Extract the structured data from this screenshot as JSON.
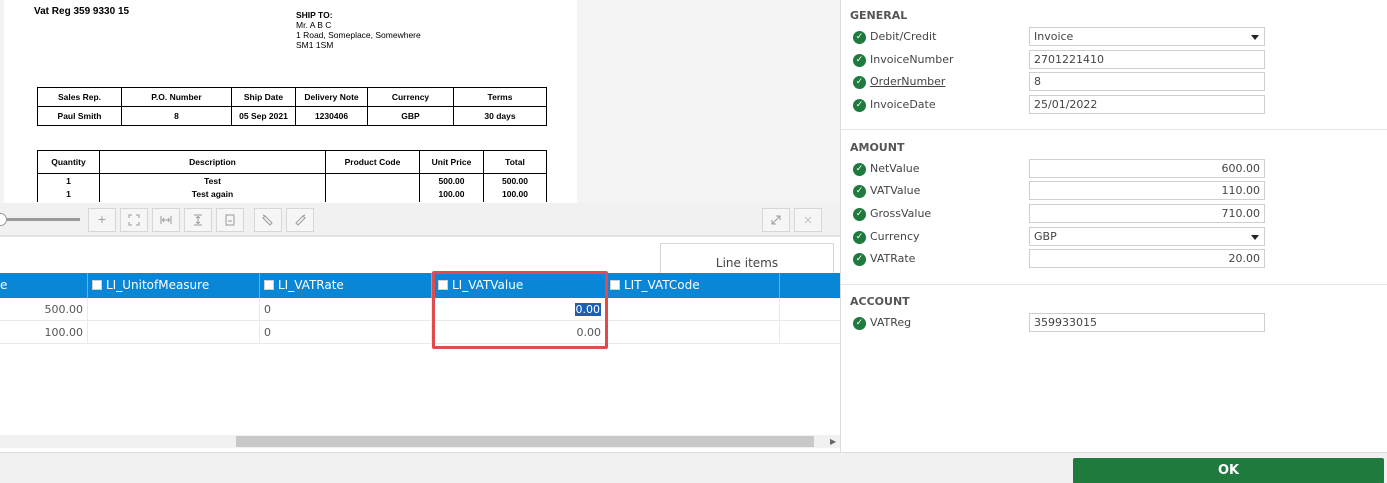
{
  "document": {
    "vat_reg": "Vat Reg 359 9330 15",
    "ship_to": {
      "title": "SHIP TO:",
      "lines": [
        "Mr. A B C",
        "1 Road, Someplace, Somewhere",
        "SM1 1SM"
      ]
    },
    "info_table": {
      "headers": [
        "Sales Rep.",
        "P.O. Number",
        "Ship Date",
        "Delivery Note",
        "Currency",
        "Terms"
      ],
      "values": [
        "Paul Smith",
        "8",
        "05 Sep 2021",
        "1230406",
        "GBP",
        "30 days"
      ]
    },
    "items_table": {
      "headers": [
        "Quantity",
        "Description",
        "Product Code",
        "Unit Price",
        "Total"
      ],
      "rows": [
        [
          "1",
          "Test",
          "",
          "500.00",
          "500.00"
        ],
        [
          "1",
          "Test again",
          "",
          "100.00",
          "100.00"
        ]
      ]
    }
  },
  "toolbar": {
    "zoom_in": "+",
    "icons": [
      "zoom-in-icon",
      "fit-page-icon",
      "fit-width-icon",
      "fit-height-icon",
      "actual-size-icon",
      "rotate-left-icon",
      "rotate-right-icon",
      "expand-icon",
      "close-icon"
    ]
  },
  "line_items": {
    "tab_label": "Line items",
    "columns": [
      "e",
      "LI_UnitofMeasure",
      "LI_VATRate",
      "LI_VATValue",
      "LIT_VATCode"
    ],
    "rows": [
      [
        "500.00",
        "",
        "0",
        "0.00",
        ""
      ],
      [
        "100.00",
        "",
        "0",
        "0.00",
        ""
      ]
    ]
  },
  "panel": {
    "general": {
      "title": "GENERAL",
      "fields": [
        {
          "label": "Debit/Credit",
          "value": "Invoice"
        },
        {
          "label": "InvoiceNumber",
          "value": "2701221410"
        },
        {
          "label": "OrderNumber",
          "value": "8"
        },
        {
          "label": "InvoiceDate",
          "value": "25/01/2022"
        }
      ]
    },
    "amount": {
      "title": "AMOUNT",
      "fields": [
        {
          "label": "NetValue",
          "value": "600.00"
        },
        {
          "label": "VATValue",
          "value": "110.00"
        },
        {
          "label": "GrossValue",
          "value": "710.00"
        },
        {
          "label": "Currency",
          "value": "GBP"
        },
        {
          "label": "VATRate",
          "value": "20.00"
        }
      ]
    },
    "account": {
      "title": "ACCOUNT",
      "fields": [
        {
          "label": "VATReg",
          "value": "359933015"
        }
      ]
    }
  },
  "footer": {
    "ok_label": "OK"
  },
  "colors": {
    "accent": "#0a86d6",
    "ok": "#1f7a3e",
    "highlight": "#e04b4b"
  }
}
